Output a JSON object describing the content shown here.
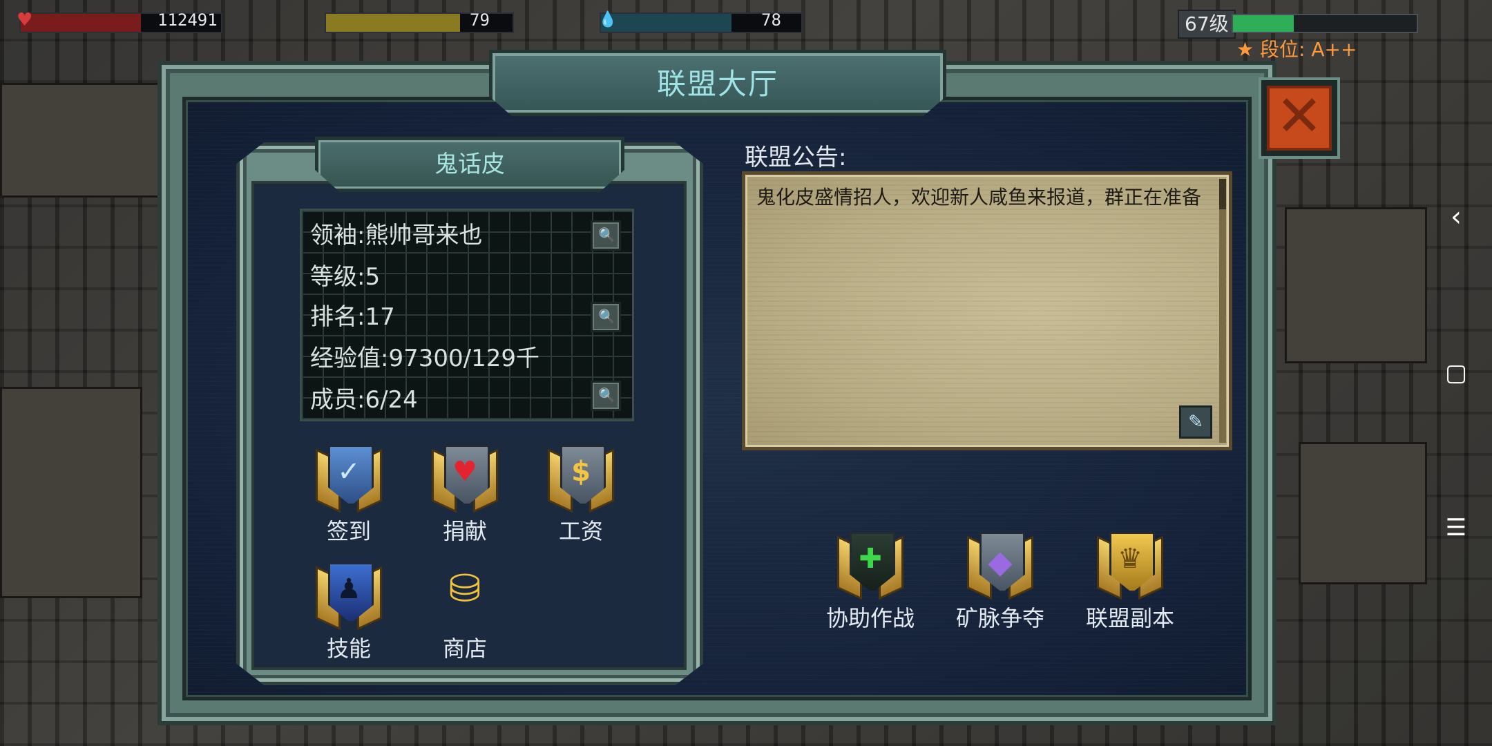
{
  "hud": {
    "hp_value": "112491",
    "gold_value": "79",
    "water_value": "78",
    "level_label": "67级",
    "level_progress": 0.33,
    "rank_label": "段位: A++"
  },
  "window": {
    "title": "联盟大厅"
  },
  "guild": {
    "name": "鬼话皮",
    "info": [
      {
        "text": "领袖:熊帅哥来也"
      },
      {
        "text": "等级:5"
      },
      {
        "text": "排名:17"
      },
      {
        "text": "经验值:97300/129千"
      },
      {
        "text": "成员:6/24"
      }
    ],
    "actions": [
      {
        "label": "签到",
        "icon": "check-shield-icon"
      },
      {
        "label": "捐献",
        "icon": "heart-icon"
      },
      {
        "label": "工资",
        "icon": "dollar-icon"
      },
      {
        "label": "技能",
        "icon": "skill-figure-icon"
      },
      {
        "label": "商店",
        "icon": "coins-icon"
      }
    ]
  },
  "notice": {
    "label": "联盟公告:",
    "text": "鬼化皮盛情招人，欢迎新人咸鱼来报道，群正在准备"
  },
  "features": [
    {
      "label": "协助作战",
      "icon": "green-cross-icon"
    },
    {
      "label": "矿脉争夺",
      "icon": "crystal-icon"
    },
    {
      "label": "联盟副本",
      "icon": "eagle-icon"
    }
  ],
  "colors": {
    "title_text": "#9fe3e6",
    "close_button": "#c74a1c",
    "rank_text": "#ff9a3c",
    "level_fill": "#2fae5a"
  }
}
